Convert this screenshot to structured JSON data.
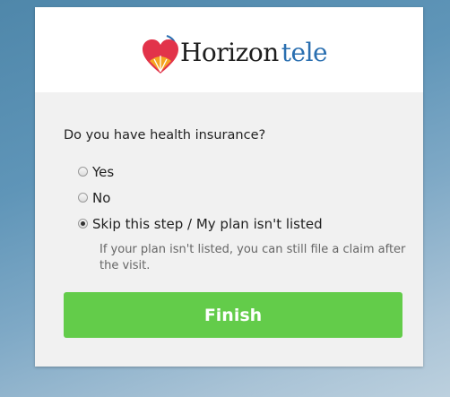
{
  "brand": {
    "name_part1": "Horizon",
    "name_part2": "tele",
    "heart_color": "#e2334a",
    "accent_color": "#f5a623",
    "text_color_part2": "#2a6fb0"
  },
  "form": {
    "question": "Do you have health insurance?",
    "options": [
      {
        "label": "Yes",
        "selected": false
      },
      {
        "label": "No",
        "selected": false
      },
      {
        "label": "Skip this step / My plan isn't listed",
        "selected": true
      }
    ],
    "help_text": "If your plan isn't listed, you can still file a claim after the visit.",
    "submit_label": "Finish",
    "submit_color": "#63cc4a"
  }
}
